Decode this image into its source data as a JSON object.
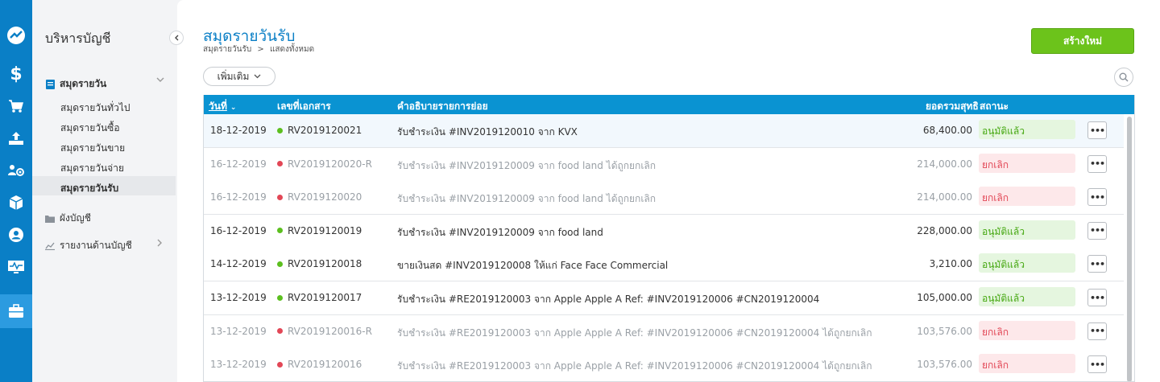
{
  "rail": {
    "items": [
      {
        "icon": "logo-icon"
      },
      {
        "icon": "dollar-icon"
      },
      {
        "icon": "cart-icon"
      },
      {
        "icon": "upload-tray-icon"
      },
      {
        "icon": "contacts-gear-icon"
      },
      {
        "icon": "box-icon"
      },
      {
        "icon": "user-circle-icon"
      },
      {
        "icon": "monitor-pulse-icon"
      },
      {
        "icon": "briefcase-icon",
        "active": true
      }
    ]
  },
  "sidebar": {
    "title": "บริหารบัญชี",
    "journal": {
      "label": "สมุดรายวัน",
      "items": [
        "สมุดรายวันทั่วไป",
        "สมุดรายวันซื้อ",
        "สมุดรายวันขาย",
        "สมุดรายวันจ่าย",
        "สมุดรายวันรับ"
      ],
      "active": "สมุดรายวันรับ"
    },
    "chart_of_accounts": "ผังบัญชี",
    "reports": "รายงานด้านบัญชี"
  },
  "header": {
    "title": "สมุดรายวันรับ",
    "breadcrumb": [
      "สมุดรายวันรับ",
      ">",
      "แสดงทั้งหมด"
    ],
    "create_label": "สร้างใหม่"
  },
  "toolbar": {
    "more_label": "เพิ่มเติม"
  },
  "table": {
    "columns": {
      "date": "วันที่",
      "doc": "เลขที่เอกสาร",
      "desc": "คำอธิบายรายการย่อย",
      "amount": "ยอดรวมสุทธิ",
      "status": "สถานะ"
    },
    "rows": [
      {
        "date": "18-12-2019",
        "doc": "RV2019120021",
        "desc": "รับชำระเงิน #INV2019120010 จาก KVX",
        "amount": "68,400.00",
        "status": "อนุมัติแล้ว",
        "state": "ok"
      },
      {
        "date": "16-12-2019",
        "doc": "RV2019120020-R",
        "desc": "รับชำระเงิน #INV2019120009 จาก food land ได้ถูกยกเลิก",
        "amount": "214,000.00",
        "status": "ยกเลิก",
        "state": "cancel"
      },
      {
        "date": "16-12-2019",
        "doc": "RV2019120020",
        "desc": "รับชำระเงิน #INV2019120009 จาก food land ได้ถูกยกเลิก",
        "amount": "214,000.00",
        "status": "ยกเลิก",
        "state": "cancel"
      },
      {
        "date": "16-12-2019",
        "doc": "RV2019120019",
        "desc": "รับชำระเงิน #INV2019120009 จาก food land",
        "amount": "228,000.00",
        "status": "อนุมัติแล้ว",
        "state": "ok"
      },
      {
        "date": "14-12-2019",
        "doc": "RV2019120018",
        "desc": "ขายเงินสด #INV2019120008 ให้แก่ Face Face Commercial",
        "amount": "3,210.00",
        "status": "อนุมัติแล้ว",
        "state": "ok"
      },
      {
        "date": "13-12-2019",
        "doc": "RV2019120017",
        "desc": "รับชำระเงิน #RE2019120003 จาก Apple Apple A Ref: #INV2019120006 #CN2019120004",
        "amount": "105,000.00",
        "status": "อนุมัติแล้ว",
        "state": "ok"
      },
      {
        "date": "13-12-2019",
        "doc": "RV2019120016-R",
        "desc": "รับชำระเงิน #RE2019120003 จาก Apple Apple A Ref: #INV2019120006 #CN2019120004 ได้ถูกยกเลิก",
        "amount": "103,576.00",
        "status": "ยกเลิก",
        "state": "cancel"
      },
      {
        "date": "13-12-2019",
        "doc": "RV2019120016",
        "desc": "รับชำระเงิน #RE2019120003 จาก Apple Apple A Ref: #INV2019120006 #CN2019120004 ได้ถูกยกเลิก",
        "amount": "103,576.00",
        "status": "ยกเลิก",
        "state": "cancel"
      }
    ]
  },
  "colors": {
    "brand": "#0a7fc6",
    "header": "#0a93d2",
    "create": "#6cc31b",
    "ok_dot": "#5cbf1f",
    "cancel_dot": "#e24756"
  }
}
